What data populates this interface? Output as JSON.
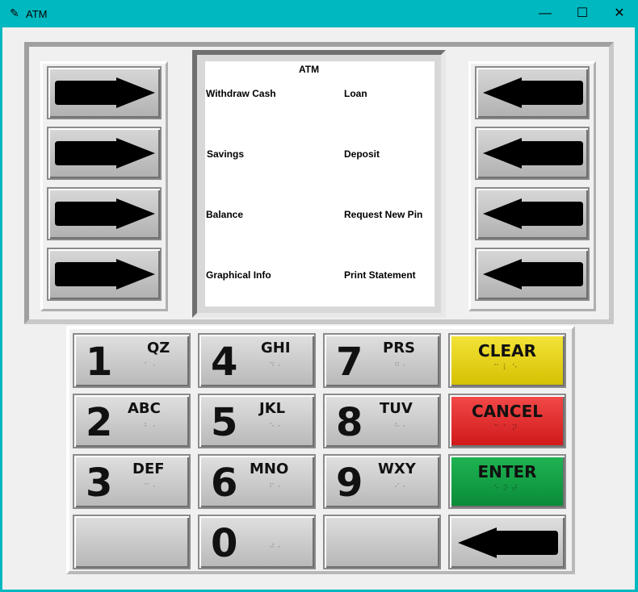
{
  "window": {
    "title": "ATM",
    "minimize": "—",
    "maximize": "☐",
    "close": "✕"
  },
  "screen": {
    "title": "ATM",
    "left_options": [
      "Withdraw Cash",
      "Savings",
      "Balance",
      "Graphical Info"
    ],
    "right_options": [
      "Loan",
      "Deposit",
      "Request New Pin",
      "Print Statement"
    ]
  },
  "side_buttons": {
    "left_icon": "arrow-right-icon",
    "right_icon": "arrow-left-icon"
  },
  "keypad": {
    "k1": {
      "num": "1",
      "letters": "QZ"
    },
    "k2": {
      "num": "2",
      "letters": "ABC"
    },
    "k3": {
      "num": "3",
      "letters": "DEF"
    },
    "k4": {
      "num": "4",
      "letters": "GHI"
    },
    "k5": {
      "num": "5",
      "letters": "JKL"
    },
    "k6": {
      "num": "6",
      "letters": "MNO"
    },
    "k7": {
      "num": "7",
      "letters": "PRS"
    },
    "k8": {
      "num": "8",
      "letters": "TUV"
    },
    "k9": {
      "num": "9",
      "letters": "WXY"
    },
    "k0": {
      "num": "0",
      "letters": ""
    },
    "clear": "CLEAR",
    "cancel": "CANCEL",
    "enter": "ENTER"
  },
  "colors": {
    "titlebar": "#00b8c0",
    "clear": "#e6d400",
    "cancel": "#e02828",
    "enter": "#12a044"
  }
}
